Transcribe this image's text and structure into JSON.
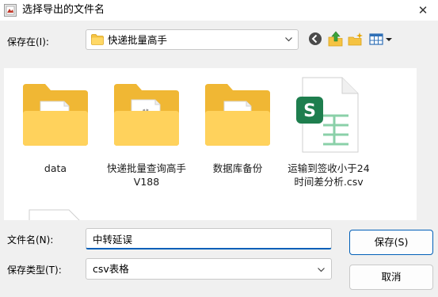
{
  "window": {
    "title": "选择导出的文件名",
    "close_glyph": "✕"
  },
  "location": {
    "label": "保存在(I):",
    "value": "快递批量高手"
  },
  "toolbar": [
    "back-icon",
    "up-folder-icon",
    "new-folder-icon",
    "view-menu-icon"
  ],
  "files": [
    {
      "name": "data",
      "type": "folder"
    },
    {
      "name": "快递批量查询高手\nV188",
      "type": "folder"
    },
    {
      "name": "数据库备份",
      "type": "folder"
    },
    {
      "name": "运输到签收小于24\n时间差分析.csv",
      "type": "csv",
      "icon_letter": "S"
    }
  ],
  "filename": {
    "label": "文件名(N):",
    "value": "中转延误"
  },
  "filetype": {
    "label": "保存类型(T):",
    "value": "csv表格"
  },
  "buttons": {
    "save": "保存(S)",
    "cancel": "取消"
  },
  "colors": {
    "accent": "#005fb8",
    "folder": "#f5c342",
    "sheet_green": "#1e7e4e"
  }
}
